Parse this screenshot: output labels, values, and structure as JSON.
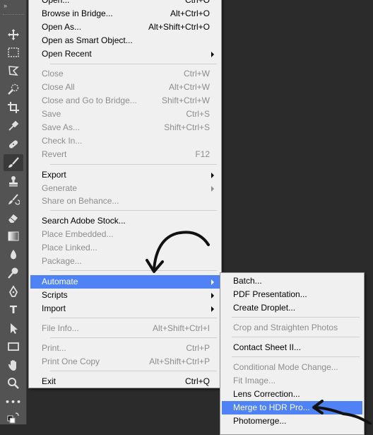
{
  "file_menu": {
    "items": [
      {
        "label": "Open...",
        "shortcut": "Ctrl+O",
        "disabled": false,
        "submenu": false
      },
      {
        "label": "Browse in Bridge...",
        "shortcut": "Alt+Ctrl+O",
        "disabled": false,
        "submenu": false
      },
      {
        "label": "Open As...",
        "shortcut": "Alt+Shift+Ctrl+O",
        "disabled": false,
        "submenu": false
      },
      {
        "label": "Open as Smart Object...",
        "shortcut": "",
        "disabled": false,
        "submenu": false
      },
      {
        "label": "Open Recent",
        "shortcut": "",
        "disabled": false,
        "submenu": true
      },
      {
        "label": "Close",
        "shortcut": "Ctrl+W",
        "disabled": true,
        "submenu": false
      },
      {
        "label": "Close All",
        "shortcut": "Alt+Ctrl+W",
        "disabled": true,
        "submenu": false
      },
      {
        "label": "Close and Go to Bridge...",
        "shortcut": "Shift+Ctrl+W",
        "disabled": true,
        "submenu": false
      },
      {
        "label": "Save",
        "shortcut": "Ctrl+S",
        "disabled": true,
        "submenu": false
      },
      {
        "label": "Save As...",
        "shortcut": "Shift+Ctrl+S",
        "disabled": true,
        "submenu": false
      },
      {
        "label": "Check In...",
        "shortcut": "",
        "disabled": true,
        "submenu": false
      },
      {
        "label": "Revert",
        "shortcut": "F12",
        "disabled": true,
        "submenu": false
      },
      {
        "label": "Export",
        "shortcut": "",
        "disabled": false,
        "submenu": true
      },
      {
        "label": "Generate",
        "shortcut": "",
        "disabled": true,
        "submenu": true
      },
      {
        "label": "Share on Behance...",
        "shortcut": "",
        "disabled": true,
        "submenu": false
      },
      {
        "label": "Search Adobe Stock...",
        "shortcut": "",
        "disabled": false,
        "submenu": false
      },
      {
        "label": "Place Embedded...",
        "shortcut": "",
        "disabled": true,
        "submenu": false
      },
      {
        "label": "Place Linked...",
        "shortcut": "",
        "disabled": true,
        "submenu": false
      },
      {
        "label": "Package...",
        "shortcut": "",
        "disabled": true,
        "submenu": false
      },
      {
        "label": "Automate",
        "shortcut": "",
        "disabled": false,
        "submenu": true,
        "highlighted": true
      },
      {
        "label": "Scripts",
        "shortcut": "",
        "disabled": false,
        "submenu": true
      },
      {
        "label": "Import",
        "shortcut": "",
        "disabled": false,
        "submenu": true
      },
      {
        "label": "File Info...",
        "shortcut": "Alt+Shift+Ctrl+I",
        "disabled": true,
        "submenu": false
      },
      {
        "label": "Print...",
        "shortcut": "Ctrl+P",
        "disabled": true,
        "submenu": false
      },
      {
        "label": "Print One Copy",
        "shortcut": "Alt+Shift+Ctrl+P",
        "disabled": true,
        "submenu": false
      },
      {
        "label": "Exit",
        "shortcut": "Ctrl+Q",
        "disabled": false,
        "submenu": false
      }
    ]
  },
  "automate_menu": {
    "items": [
      {
        "label": "Batch...",
        "disabled": false
      },
      {
        "label": "PDF Presentation...",
        "disabled": false
      },
      {
        "label": "Create Droplet...",
        "disabled": false
      },
      {
        "label": "Crop and Straighten Photos",
        "disabled": true
      },
      {
        "label": "Contact Sheet II...",
        "disabled": false
      },
      {
        "label": "Conditional Mode Change...",
        "disabled": true
      },
      {
        "label": "Fit Image...",
        "disabled": true
      },
      {
        "label": "Lens Correction...",
        "disabled": false
      },
      {
        "label": "Merge to HDR Pro...",
        "disabled": false,
        "highlighted": true
      },
      {
        "label": "Photomerge...",
        "disabled": false
      }
    ]
  },
  "toolbar": {
    "collapse_label": "››",
    "tools": [
      "move-tool-icon",
      "marquee-tool-icon",
      "lasso-tool-icon",
      "quick-selection-tool-icon",
      "crop-tool-icon",
      "eyedropper-tool-icon",
      "healing-brush-tool-icon",
      "brush-tool-icon",
      "clone-stamp-tool-icon",
      "history-brush-tool-icon",
      "eraser-tool-icon",
      "gradient-tool-icon",
      "blur-tool-icon",
      "dodge-tool-icon",
      "pen-tool-icon",
      "type-tool-icon",
      "path-selection-tool-icon",
      "rectangle-tool-icon",
      "hand-tool-icon",
      "zoom-tool-icon",
      "more-tools-icon",
      "color-swatches-icon"
    ],
    "type_glyph": "T",
    "more_glyph": "•••",
    "active_tool": "brush-tool-icon"
  },
  "colors": {
    "highlight": "#4f82f5",
    "menu_bg": "#f0f0f0",
    "disabled_text": "#8d8d8d",
    "toolbar_bg": "#535353",
    "canvas_bg": "#2b2b2b"
  }
}
